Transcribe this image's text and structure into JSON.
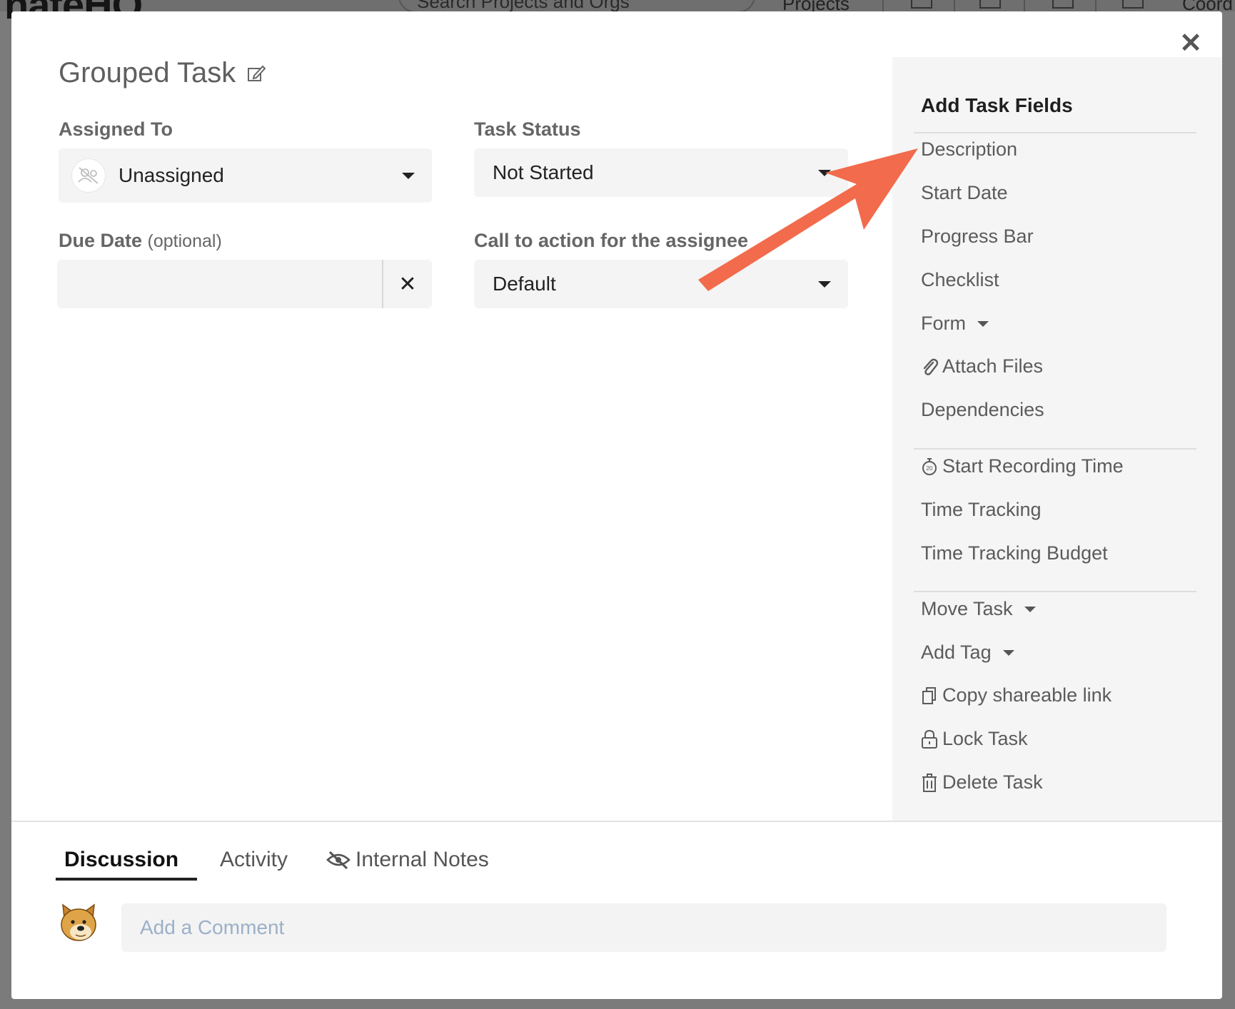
{
  "background": {
    "logo_text": "nateHQ",
    "search_placeholder": "Search Projects and Orgs",
    "projects_label": "Projects",
    "right_label": "Coord"
  },
  "modal": {
    "title": "Grouped Task",
    "close_symbol": "✕"
  },
  "fields": {
    "assigned_to": {
      "label": "Assigned To",
      "value": "Unassigned"
    },
    "task_status": {
      "label": "Task Status",
      "value": "Not Started"
    },
    "due_date": {
      "label": "Due Date",
      "optional": "(optional)",
      "value": "",
      "clear_symbol": "✕"
    },
    "call_to_action": {
      "label": "Call to action for the assignee",
      "value": "Default"
    }
  },
  "panel": {
    "title": "Add Task Fields",
    "group1": [
      {
        "label": "Description"
      },
      {
        "label": "Start Date"
      },
      {
        "label": "Progress Bar"
      },
      {
        "label": "Checklist"
      },
      {
        "label": "Form"
      },
      {
        "label": "Attach Files"
      },
      {
        "label": "Dependencies"
      }
    ],
    "group2": [
      {
        "label": "Start Recording Time"
      },
      {
        "label": "Time Tracking"
      },
      {
        "label": "Time Tracking Budget"
      }
    ],
    "group3": [
      {
        "label": "Move Task"
      },
      {
        "label": "Add Tag"
      },
      {
        "label": "Copy shareable link"
      },
      {
        "label": "Lock Task"
      },
      {
        "label": "Delete Task"
      }
    ]
  },
  "tabs": [
    {
      "label": "Discussion",
      "active": true
    },
    {
      "label": "Activity",
      "active": false
    },
    {
      "label": "Internal Notes",
      "active": false
    }
  ],
  "comment": {
    "placeholder": "Add a Comment",
    "value": ""
  },
  "colors": {
    "arrow": "#f26b4c",
    "accent": "#222222"
  }
}
